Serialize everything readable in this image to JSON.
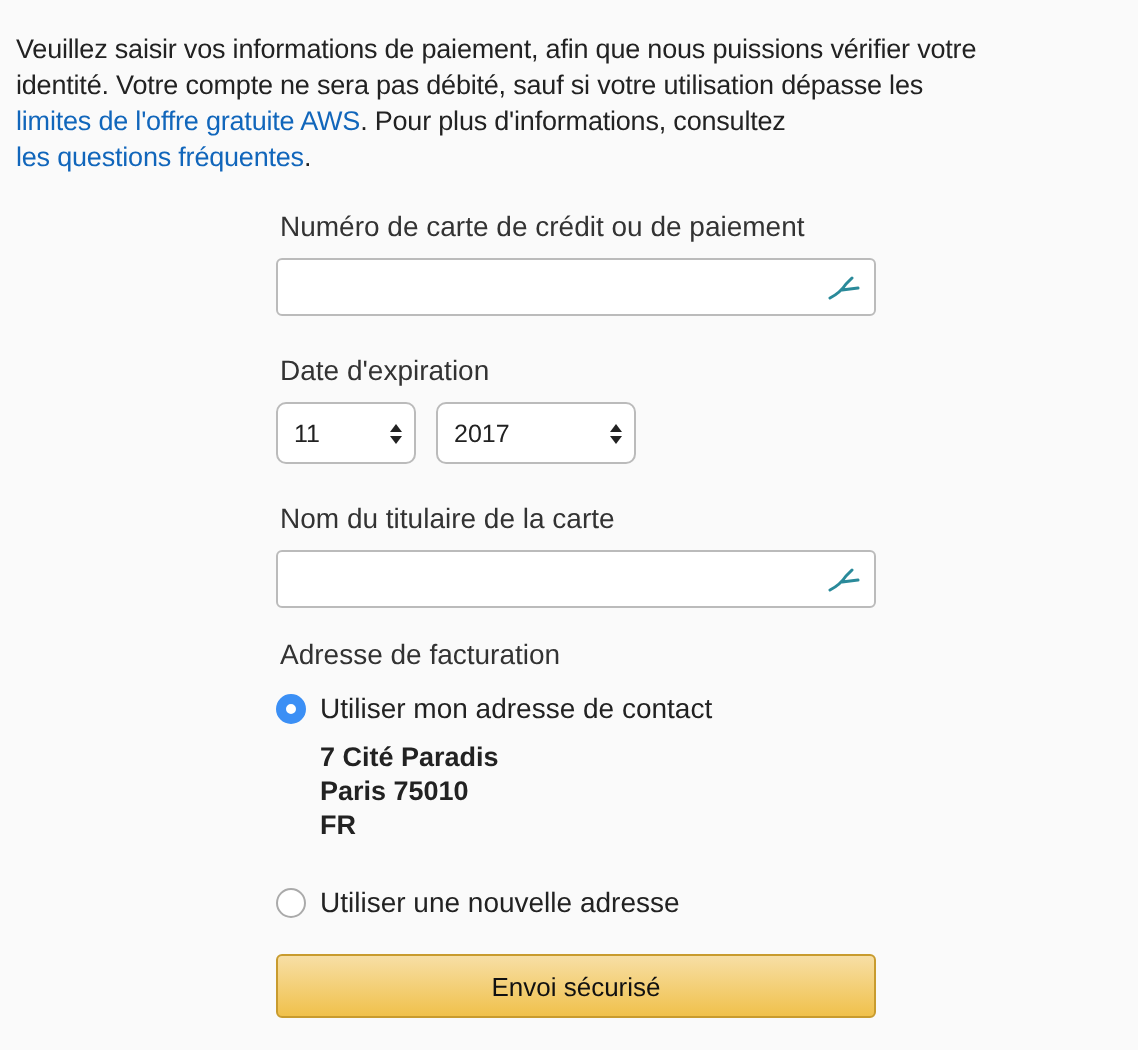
{
  "intro": [
    {
      "kind": "text",
      "text": "Veuillez saisir vos informations de paiement, afin que nous puissions vérifier votre identité. Votre compte ne sera pas débité, sauf si votre utilisation dépasse les "
    },
    {
      "kind": "link",
      "text": "limites de l'offre gratuite AWS"
    },
    {
      "kind": "text",
      "text": ". Pour plus d'informations, consultez "
    },
    {
      "kind": "link",
      "text": "les questions fréquentes"
    },
    {
      "kind": "text",
      "text": "."
    }
  ],
  "card_number": {
    "label": "Numéro de carte de crédit ou de paiement"
  },
  "expiration": {
    "label": "Date d'expiration",
    "month": "11",
    "year": "2017"
  },
  "cardholder": {
    "label": "Nom du titulaire de la carte"
  },
  "billing": {
    "label": "Adresse de facturation",
    "options": [
      {
        "label": "Utiliser mon adresse de contact",
        "selected": true,
        "address": [
          "7 Cité Paradis",
          "Paris 75010",
          "FR"
        ]
      },
      {
        "label": "Utiliser une nouvelle adresse",
        "selected": false
      }
    ]
  },
  "submit": "Envoi sécurisé"
}
